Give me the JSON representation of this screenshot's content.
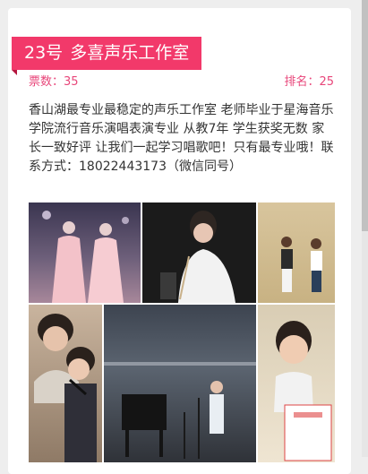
{
  "entry": {
    "number_label": "23号",
    "name": "多喜声乐工作室",
    "votes_label": "票数：",
    "votes": "35",
    "rank_label": "排名：",
    "rank": "25",
    "description": "香山湖最专业最稳定的声乐工作室 老师毕业于星海音乐学院流行音乐演唱表演专业 从教7年 学生获奖无数 家长一致好评 让我们一起学习唱歌吧！只有最专业哦！联系方式：18022443173（微信同号）"
  },
  "colors": {
    "accent": "#f2396a",
    "stat_text": "#e8467a"
  }
}
